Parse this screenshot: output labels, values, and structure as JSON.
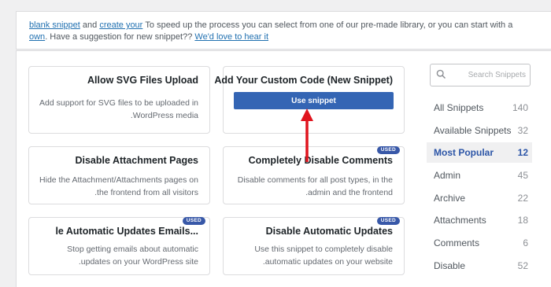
{
  "intro": {
    "text_start": "To speed up the process you can select from one of our pre-made library, or you can start with a",
    "blank_snippet_link": "blank snippet",
    "and_text": "and",
    "create_own_link": "create your own",
    "text_suggest": ". Have a suggestion for",
    "text_new_snippet": "new snippet?",
    "love_link": "We'd love to hear it"
  },
  "cards": {
    "svg": {
      "title": "Allow SVG Files Upload",
      "desc": "Add support for SVG files to be uploaded in WordPress media."
    },
    "custom": {
      "title": "Add Your Custom Code (New Snippet)",
      "button": "Use snippet"
    },
    "attachment": {
      "title": "Disable Attachment Pages",
      "desc": "Hide the Attachment/Attachments pages on the frontend from all visitors."
    },
    "comments": {
      "title": "Completely Disable Comments",
      "desc": "Disable comments for all post types, in the admin and the frontend.",
      "badge": "USED"
    },
    "update_emails": {
      "title": "...le Automatic Updates Emails",
      "desc": "Stop getting emails about automatic updates on your WordPress site.",
      "badge": "USED"
    },
    "auto_updates": {
      "title": "Disable Automatic Updates",
      "desc": "Use this snippet to completely disable automatic updates on your website.",
      "badge": "USED"
    }
  },
  "sidebar": {
    "search_placeholder": "Search Snippets",
    "categories": [
      {
        "label": "All Snippets",
        "count": "140"
      },
      {
        "label": "Available Snippets",
        "count": "32"
      },
      {
        "label": "Most Popular",
        "count": "12",
        "active": true
      },
      {
        "label": "Admin",
        "count": "45"
      },
      {
        "label": "Archive",
        "count": "22"
      },
      {
        "label": "Attachments",
        "count": "18"
      },
      {
        "label": "Comments",
        "count": "6"
      },
      {
        "label": "Disable",
        "count": "52"
      }
    ]
  },
  "colors": {
    "accent": "#3465b4",
    "badge": "#3858a8",
    "arrow": "#e0141e"
  }
}
